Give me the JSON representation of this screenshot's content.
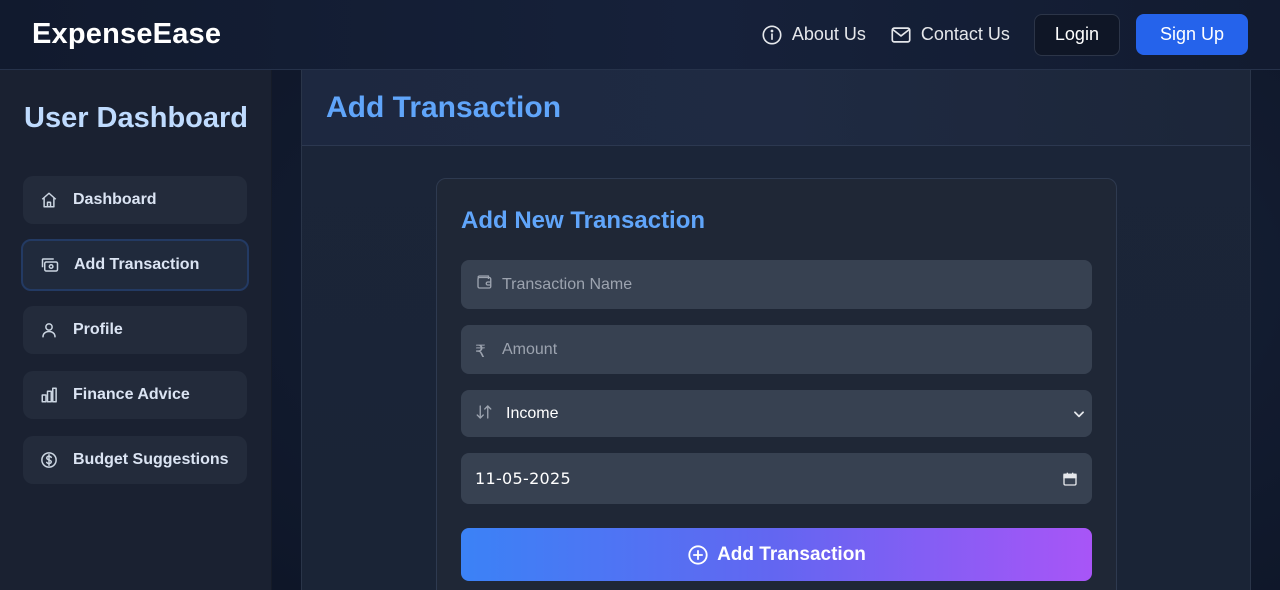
{
  "nav": {
    "brand": "ExpenseEase",
    "about": "About Us",
    "contact": "Contact Us",
    "login": "Login",
    "signup": "Sign Up"
  },
  "sidebar": {
    "title": "User Dashboard",
    "items": [
      {
        "label": "Dashboard",
        "icon": "home-icon"
      },
      {
        "label": "Add Transaction",
        "icon": "wallet-cash-icon",
        "active": true
      },
      {
        "label": "Profile",
        "icon": "user-icon"
      },
      {
        "label": "Finance Advice",
        "icon": "bar-chart-icon"
      },
      {
        "label": "Budget Suggestions",
        "icon": "dollar-circle-icon"
      }
    ]
  },
  "main": {
    "page_title": "Add Transaction",
    "form": {
      "title": "Add New Transaction",
      "name_placeholder": "Transaction Name",
      "amount_placeholder": "Amount",
      "currency_symbol": "₹",
      "type_value": "Income",
      "date_value": "11-05-2025",
      "submit_label": "Add Transaction"
    }
  },
  "colors": {
    "accent": "#60a5fa",
    "signup": "#2563eb",
    "gradient_start": "#3b82f6",
    "gradient_end": "#a855f7"
  }
}
